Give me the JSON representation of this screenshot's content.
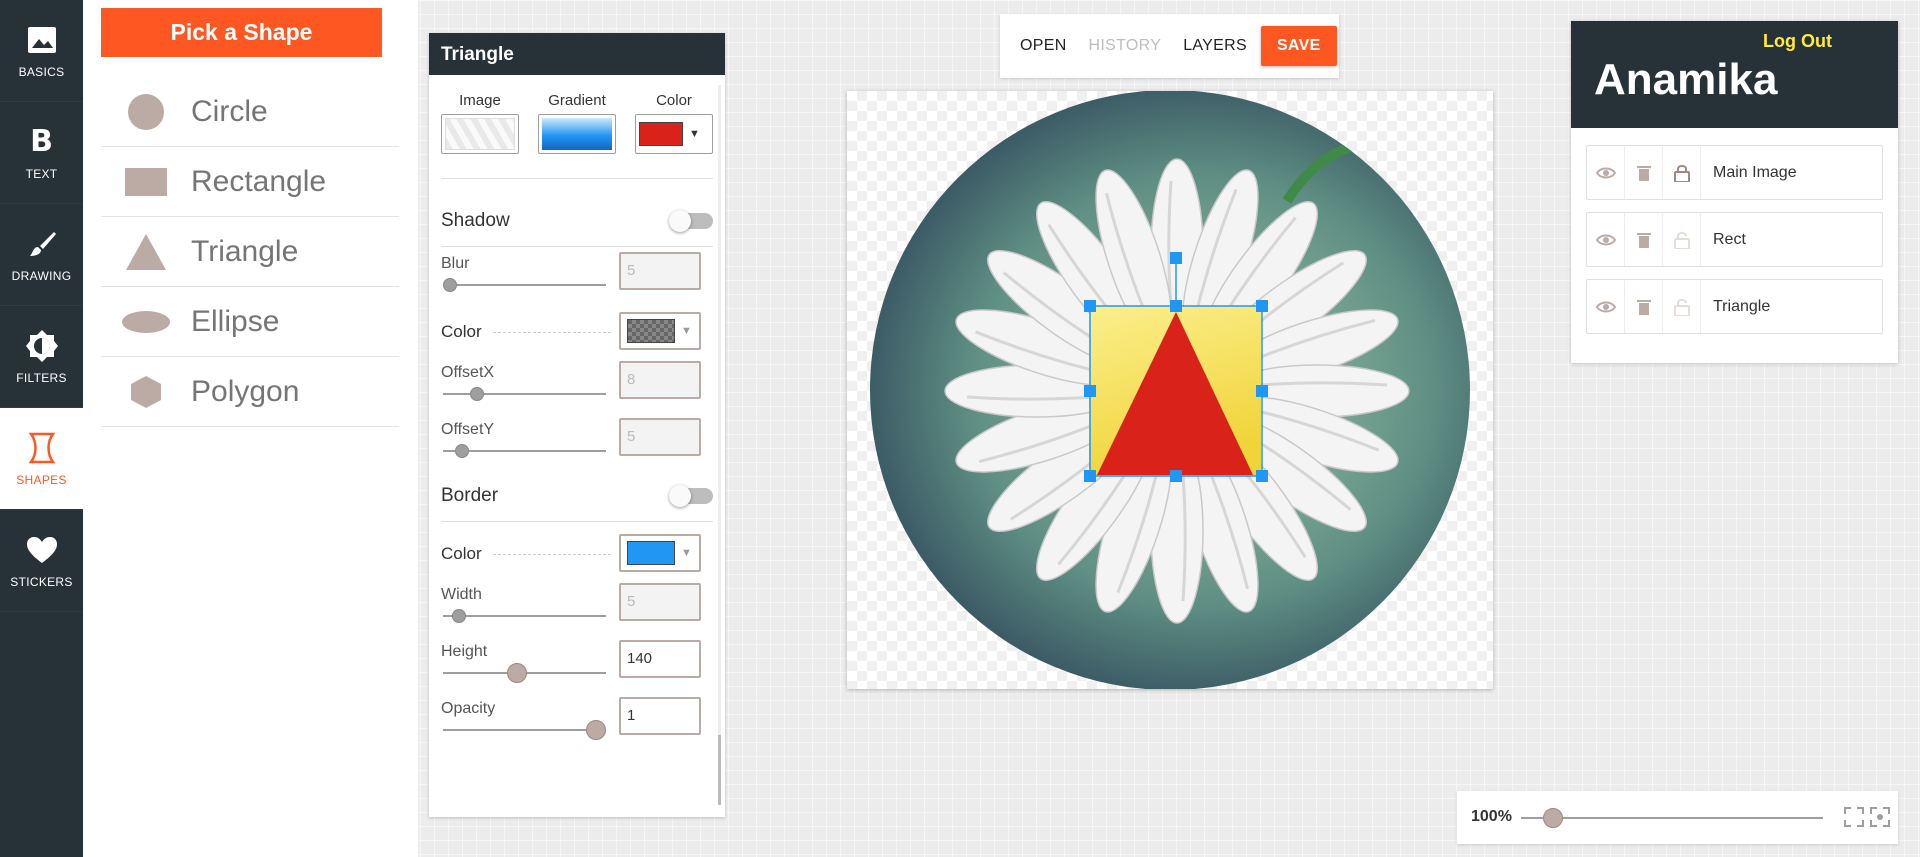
{
  "nav": {
    "items": [
      {
        "label": "BASICS",
        "icon": "image-icon"
      },
      {
        "label": "TEXT",
        "icon": "bold-b-icon"
      },
      {
        "label": "DRAWING",
        "icon": "brush-icon"
      },
      {
        "label": "FILTERS",
        "icon": "brightness-icon"
      },
      {
        "label": "SHAPES",
        "icon": "shape-icon",
        "active": true
      },
      {
        "label": "STICKERS",
        "icon": "heart-icon"
      }
    ]
  },
  "shapes_panel": {
    "title": "Pick a Shape",
    "items": [
      {
        "label": "Circle",
        "icon": "circle-icon"
      },
      {
        "label": "Rectangle",
        "icon": "rectangle-icon"
      },
      {
        "label": "Triangle",
        "icon": "triangle-icon"
      },
      {
        "label": "Ellipse",
        "icon": "ellipse-icon"
      },
      {
        "label": "Polygon",
        "icon": "hexagon-icon"
      }
    ]
  },
  "properties": {
    "title": "Triangle",
    "fill": {
      "image_label": "Image",
      "gradient_label": "Gradient",
      "color_label": "Color",
      "color": "#d8221a"
    },
    "shadow": {
      "title": "Shadow",
      "enabled": false,
      "blur": {
        "label": "Blur",
        "value": "5",
        "fraction": 0.0
      },
      "color": {
        "label": "Color",
        "value": "transparent"
      },
      "offset_x": {
        "label": "OffsetX",
        "value": "8",
        "fraction": 0.18
      },
      "offset_y": {
        "label": "OffsetY",
        "value": "5",
        "fraction": 0.08
      }
    },
    "border": {
      "title": "Border",
      "enabled": false,
      "color": {
        "label": "Color",
        "value": "#2196f3"
      },
      "width": {
        "label": "Width",
        "value": "5",
        "fraction": 0.06
      }
    },
    "height": {
      "label": "Height",
      "value": "140",
      "fraction": 0.45
    },
    "opacity": {
      "label": "Opacity",
      "value": "1",
      "fraction": 1.0
    }
  },
  "toolbar": {
    "open_label": "OPEN",
    "history_label": "HISTORY",
    "layers_label": "LAYERS",
    "save_label": "SAVE"
  },
  "user": {
    "name": "Anamika",
    "logout_label": "Log Out"
  },
  "layers": {
    "items": [
      {
        "name": "Main Image",
        "locked": true
      },
      {
        "name": "Rect",
        "locked": false
      },
      {
        "name": "Triangle",
        "locked": false
      }
    ]
  },
  "zoom": {
    "label": "100%",
    "fraction": 0.08
  },
  "colors": {
    "accent": "#ff5722",
    "dark": "#263238",
    "selection": "#2196f3",
    "rect_fill": "#f5e06a",
    "triangle_fill": "#d8221a"
  }
}
